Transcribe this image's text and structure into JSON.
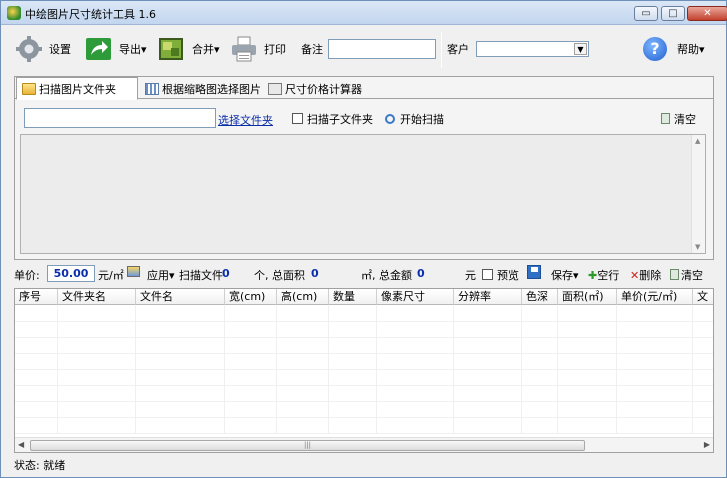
{
  "window": {
    "title": "中绘图片尺寸统计工具 1.6",
    "controls": {
      "minimize": "▭",
      "maximize": "□",
      "close": "✕"
    }
  },
  "toolbar": {
    "settings_label": "设置",
    "export_label": "导出▾",
    "merge_label": "合并▾",
    "print_label": "打印",
    "note_label": "备注",
    "note_value": "",
    "customer_label": "客户",
    "customer_value": "",
    "help_label": "帮助▾",
    "help_glyph": "?"
  },
  "tabs": [
    {
      "label": "扫描图片文件夹",
      "active": true
    },
    {
      "label": "根据缩略图选择图片",
      "active": false
    },
    {
      "label": "尺寸价格计算器",
      "active": false
    }
  ],
  "scan": {
    "folder_value": "",
    "choose_folder_link": "选择文件夹",
    "scan_subfolders_label": "扫描子文件夹",
    "start_scan_label": "开始扫描",
    "clear_label": "清空"
  },
  "calc": {
    "unit_price_label": "单价:",
    "unit_price_value": "50.00",
    "unit_price_unit": "元/㎡",
    "apply_label": "应用▾",
    "scan_files_label": "扫描文件",
    "file_count": "0",
    "file_count_unit": "个, 总面积",
    "total_area": "0",
    "total_area_unit": "㎡, 总金额",
    "total_amount": "0",
    "total_amount_unit": "元",
    "preview_label": "预览",
    "save_label": "保存▾",
    "blank_row_label": "空行",
    "delete_label": "删除",
    "clear_label": "清空"
  },
  "grid": {
    "columns": [
      "序号",
      "文件夹名",
      "文件名",
      "宽(cm)",
      "高(cm)",
      "数量",
      "像素尺寸",
      "分辨率",
      "色深",
      "面积(㎡)",
      "单价(元/㎡)",
      "文"
    ],
    "rows": [],
    "hscroll_grip": "|||"
  },
  "status": {
    "text": "状态: 就绪"
  }
}
